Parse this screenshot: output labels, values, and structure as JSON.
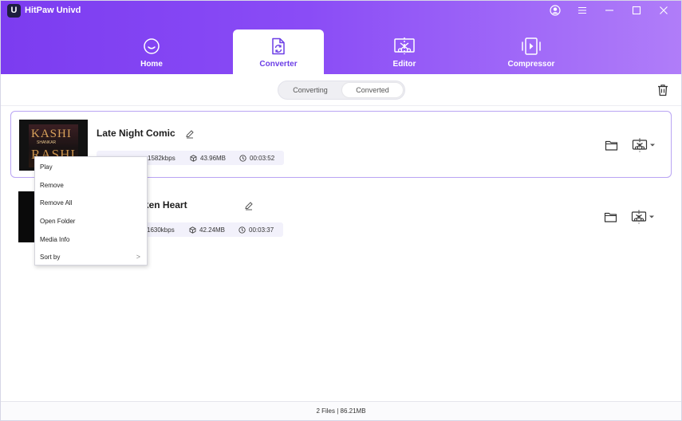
{
  "app": {
    "title": "HitPaw Univd",
    "logo_letter": "U"
  },
  "nav": {
    "tabs": [
      {
        "label": "Home",
        "icon": "home-icon"
      },
      {
        "label": "Converter",
        "icon": "converter-icon",
        "active": true
      },
      {
        "label": "Editor",
        "icon": "editor-icon"
      },
      {
        "label": "Compressor",
        "icon": "compressor-icon"
      }
    ]
  },
  "segment": {
    "converting": "Converting",
    "converted": "Converted",
    "selected": "Converted"
  },
  "files": [
    {
      "title": "Late Night Comic",
      "poster": {
        "line1": "KASHI",
        "line2": "SHANKAR",
        "line3": "RASHI"
      },
      "meta": {
        "format": "",
        "bitrate": "1582kbps",
        "size": "43.96MB",
        "duration": "00:03:52"
      },
      "selected": true
    },
    {
      "title": "With a Broken Heart",
      "meta": {
        "format": "",
        "bitrate": "1630kbps",
        "size": "42.24MB",
        "duration": "00:03:37"
      },
      "selected": false
    }
  ],
  "context_menu": {
    "items": [
      "Play",
      "Remove",
      "Remove All",
      "Open Folder",
      "Media Info",
      "Sort by"
    ],
    "submenu_arrow": ">"
  },
  "footer": {
    "summary": "2 Files | 86.21MB"
  },
  "colors": {
    "accent": "#6c3fe6",
    "header_start": "#7c3cf0",
    "header_end": "#b07df9"
  }
}
